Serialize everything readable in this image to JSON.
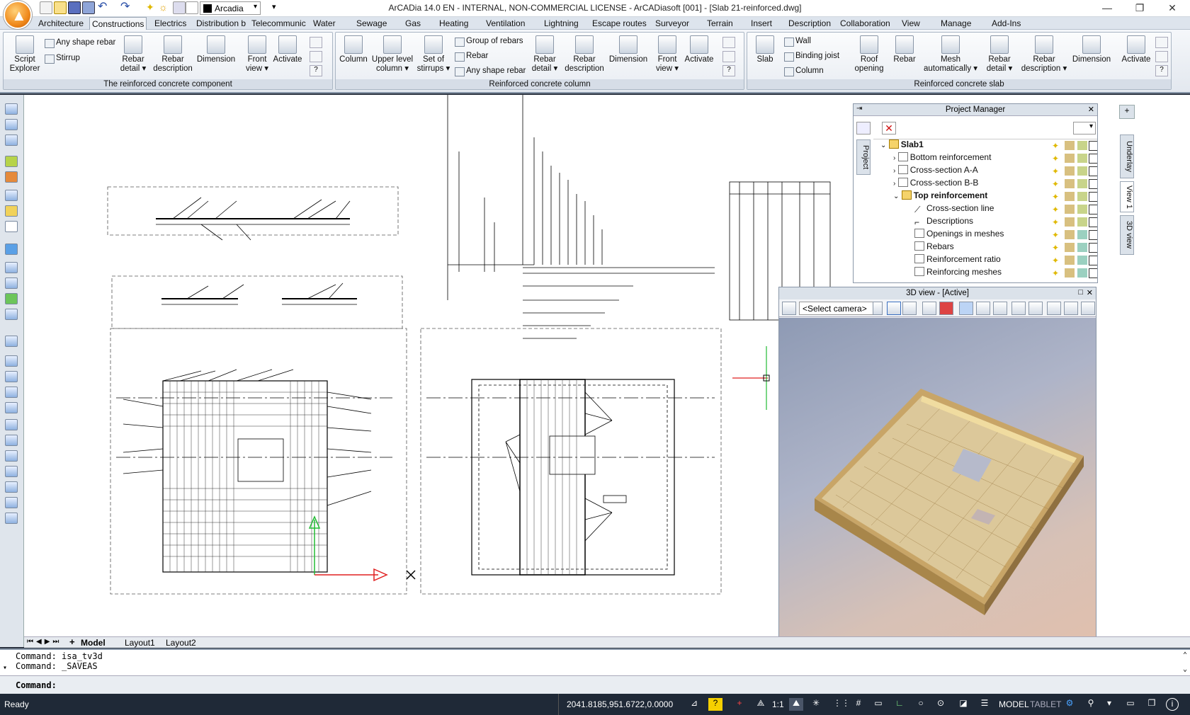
{
  "window": {
    "title": "ArCADia 14.0 EN - INTERNAL, NON-COMMERCIAL LICENSE - ArCADiasoft [001] - [Slab 21-reinforced.dwg]",
    "workspace": "Arcadia"
  },
  "menu_tabs": [
    "Architecture",
    "Constructions",
    "Electrics",
    "Distribution b",
    "Telecommunic",
    "Water",
    "Sewage",
    "Gas",
    "Heating",
    "Ventilation",
    "Lightning",
    "Escape routes",
    "Surveyor",
    "Terrain",
    "Insert",
    "Description",
    "Collaboration",
    "View",
    "Manage",
    "Add-Ins"
  ],
  "ribbon": {
    "group1": {
      "caption": "The reinforced concrete component",
      "script": "Script\nExplorer",
      "any_shape_rebar": "Any shape rebar",
      "stirrup": "Stirrup",
      "rebar_detail": "Rebar\ndetail ▾",
      "rebar_description": "Rebar\ndescription",
      "dimension": "Dimension",
      "front_view": "Front\nview ▾",
      "activate": "Activate"
    },
    "group2": {
      "caption": "Reinforced concrete column",
      "column": "Column",
      "upper_level_column": "Upper level\ncolumn ▾",
      "set_of_stirrups": "Set of\nstirrups ▾",
      "group_of_rebars": "Group of rebars",
      "rebar": "Rebar",
      "any_shape_rebar": "Any shape rebar",
      "rebar_detail": "Rebar\ndetail ▾",
      "rebar_description": "Rebar\ndescription",
      "dimension": "Dimension",
      "front_view": "Front\nview ▾",
      "activate": "Activate"
    },
    "group3": {
      "caption": "Reinforced concrete slab",
      "slab": "Slab",
      "wall": "Wall",
      "binding_joist": "Binding joist",
      "column": "Column",
      "roof_opening": "Roof\nopening",
      "rebar": "Rebar",
      "mesh_auto": "Mesh\nautomatically ▾",
      "rebar_detail": "Rebar\ndetail ▾",
      "rebar_description": "Rebar\ndescription ▾",
      "dimension": "Dimension",
      "activate": "Activate"
    }
  },
  "project_manager": {
    "title": "Project Manager",
    "side_tab": "Project",
    "items": [
      {
        "label": "Slab1",
        "bold": true
      },
      {
        "label": "Bottom reinforcement"
      },
      {
        "label": "Cross-section A-A"
      },
      {
        "label": "Cross-section B-B"
      },
      {
        "label": "Top reinforcement",
        "bold": true
      },
      {
        "label": "Cross-section line"
      },
      {
        "label": "Descriptions"
      },
      {
        "label": "Openings in meshes"
      },
      {
        "label": "Rebars"
      },
      {
        "label": "Reinforcement ratio"
      },
      {
        "label": "Reinforcing meshes"
      }
    ]
  },
  "view3d": {
    "title": "3D view - [Active]",
    "camera": "<Select camera>"
  },
  "side_tabs": [
    "Underlay",
    "View 1",
    "3D view"
  ],
  "layout_tabs": [
    "Model",
    "Layout1",
    "Layout2"
  ],
  "command": {
    "line1": "Command: isa_tv3d",
    "line2": "Command: _SAVEAS",
    "prompt": "Command:"
  },
  "status": {
    "state": "Ready",
    "coords": "2041.8185,951.6722,0.0000",
    "scale": "1:1",
    "model": "MODEL",
    "tablet": "TABLET"
  }
}
